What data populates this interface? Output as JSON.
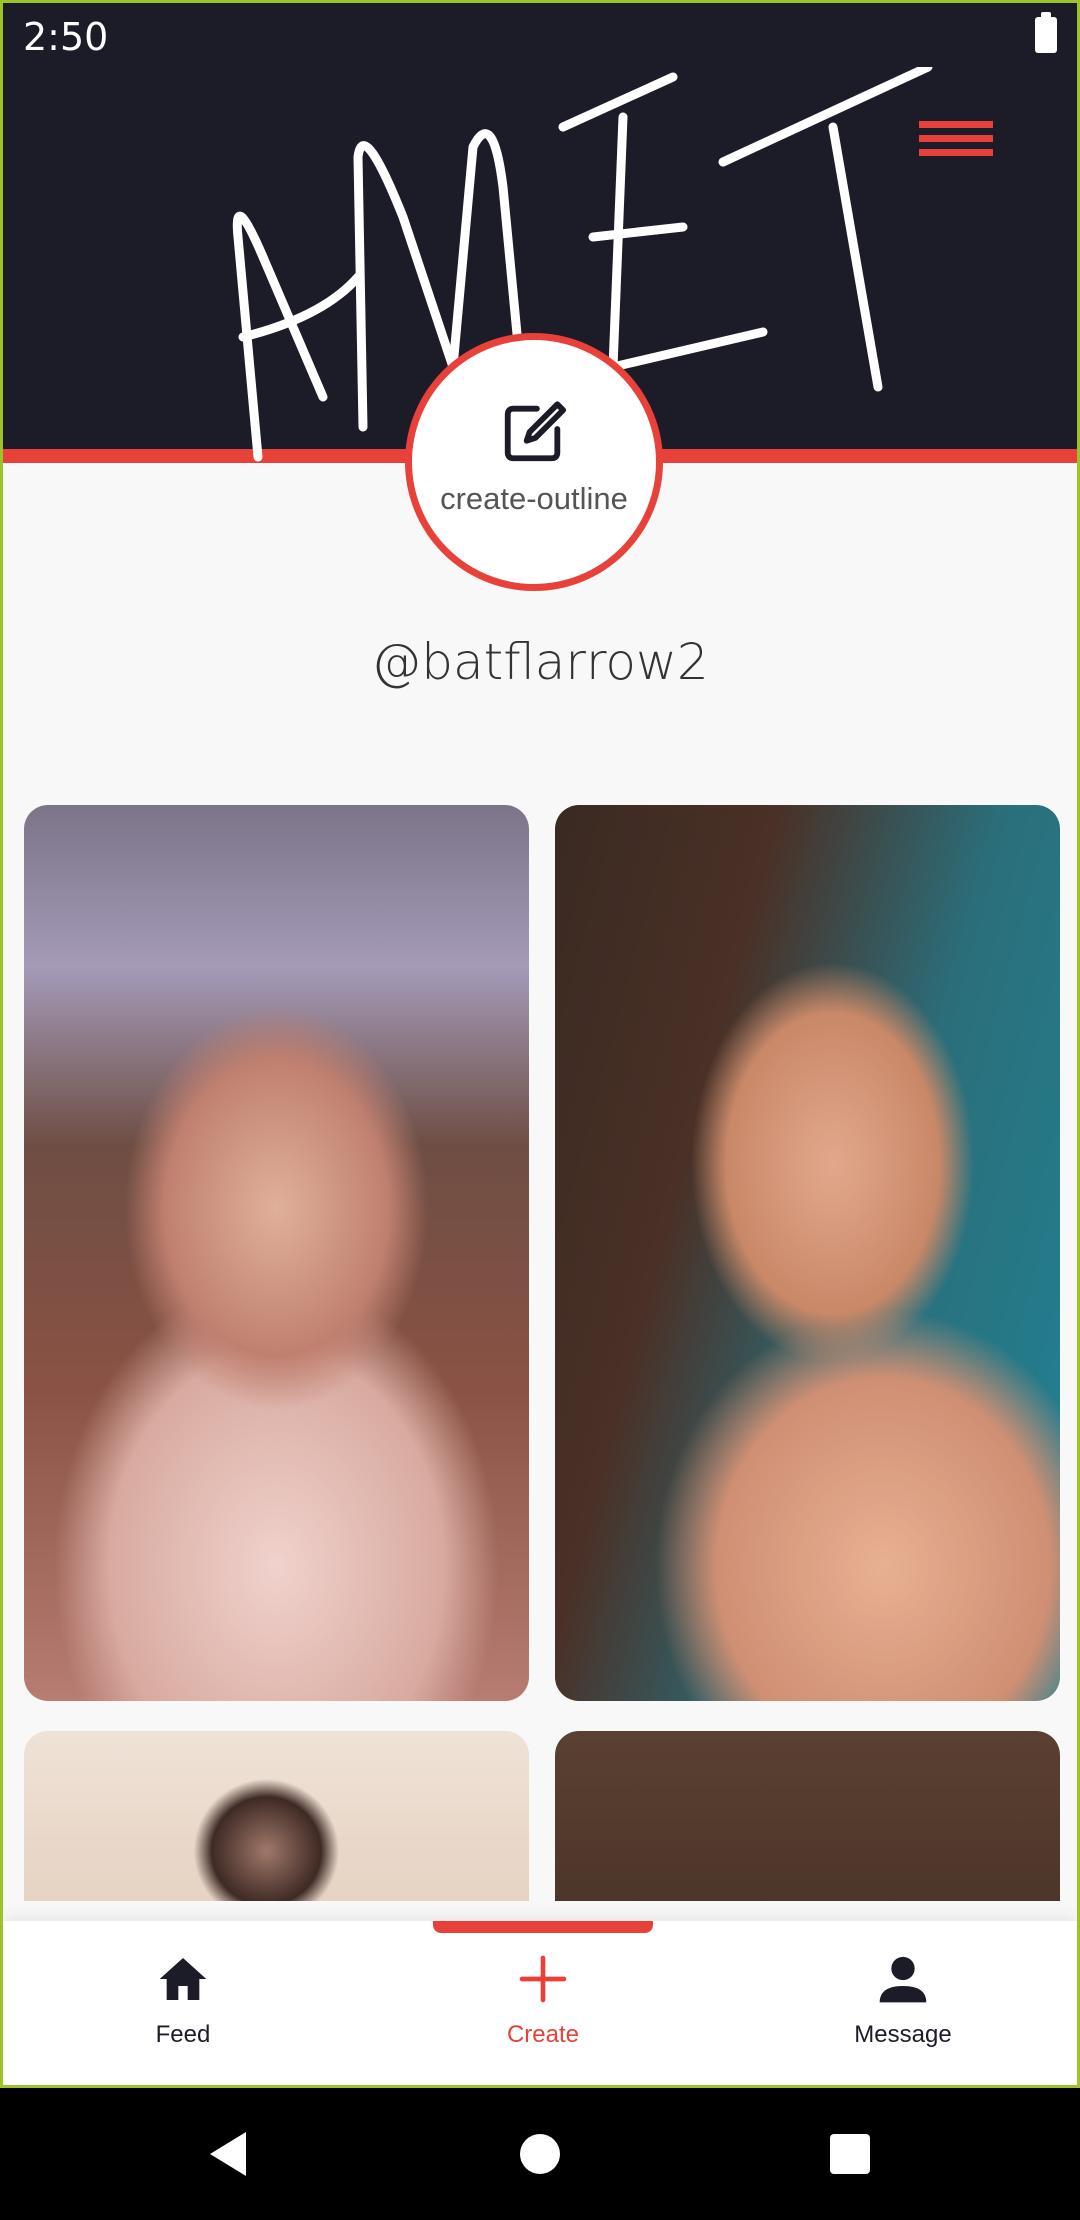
{
  "status_bar": {
    "time": "2:50",
    "battery_icon": "battery-full-icon"
  },
  "header": {
    "cover_signature_text": "AMIT",
    "menu_icon": "hamburger-menu-icon",
    "accent_color": "#e8413a",
    "background_color": "#1c1c28"
  },
  "avatar_edit": {
    "icon": "create-outline-icon",
    "label": "create-outline"
  },
  "profile": {
    "username": "@batflarrow2"
  },
  "grid": {
    "tiles": [
      {
        "icon": "photo-thumbnail"
      },
      {
        "icon": "photo-thumbnail"
      },
      {
        "icon": "photo-thumbnail"
      },
      {
        "icon": "photo-thumbnail"
      }
    ]
  },
  "bottom_nav": {
    "active_color": "#e8413a",
    "inactive_color": "#1c1c28",
    "items": [
      {
        "label": "Feed",
        "icon": "home-icon",
        "active": false
      },
      {
        "label": "Create",
        "icon": "plus-icon",
        "active": true
      },
      {
        "label": "Message",
        "icon": "person-icon",
        "active": false
      }
    ]
  },
  "system_nav": {
    "back_icon": "back-triangle-icon",
    "home_icon": "home-circle-icon",
    "recents_icon": "recents-square-icon"
  }
}
